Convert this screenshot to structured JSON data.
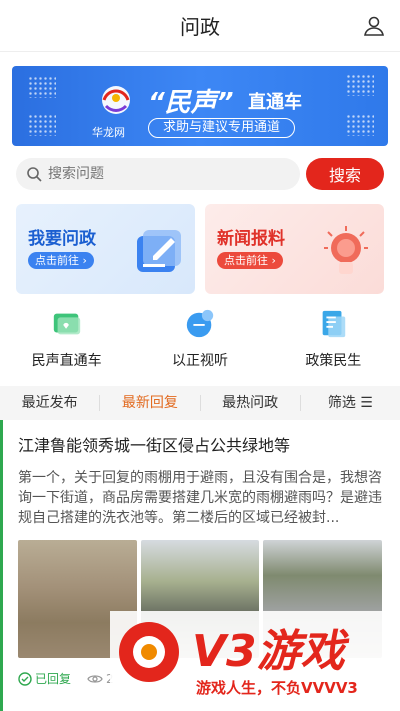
{
  "header": {
    "title": "问政"
  },
  "banner": {
    "logo_text": "华龙网",
    "headline": "“民声”",
    "headline2": "直通车",
    "tagline": "求助与建议专用通道"
  },
  "search": {
    "placeholder": "搜索问题",
    "button": "搜索"
  },
  "cards": [
    {
      "title": "我要问政",
      "go": "点击前往 ›"
    },
    {
      "title": "新闻报料",
      "go": "点击前往 ›"
    }
  ],
  "quick": [
    {
      "label": "民声直通车",
      "icon": "chat-card-icon"
    },
    {
      "label": "以正视听",
      "icon": "speech-bubble-icon"
    },
    {
      "label": "政策民生",
      "icon": "document-icon"
    }
  ],
  "tabs": [
    {
      "label": "最近发布",
      "active": false
    },
    {
      "label": "最新回复",
      "active": true
    },
    {
      "label": "最热问政",
      "active": false
    },
    {
      "label": "筛选 ☰",
      "active": false
    }
  ],
  "article": {
    "title": "江津鲁能领秀城一街区侵占公共绿地等",
    "body": "第一个，关于回复的雨棚用于避雨，且没有围合是，我想咨询一下街道，商品房需要搭建几米宽的雨棚避雨吗？是避违规自己搭建的洗衣池等。第二楼后的区域已经被封...",
    "status": "已回复",
    "views": "2"
  },
  "watermark": {
    "brand": "V3游戏",
    "slogan": "游戏人生，不负VVVV3"
  },
  "colors": {
    "primary_red": "#e3261c",
    "accent_orange": "#e26a1f",
    "green": "#2fa84f",
    "blue": "#1b5fd1"
  }
}
